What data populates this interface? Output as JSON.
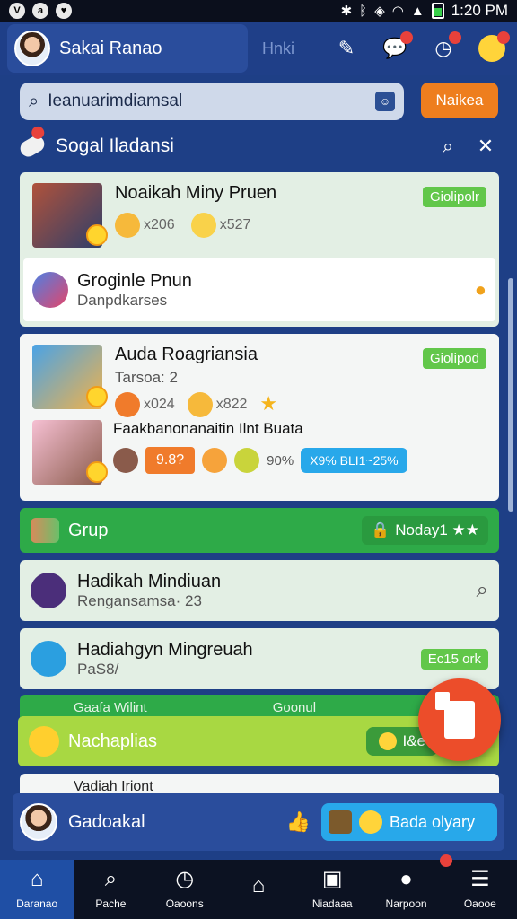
{
  "status_bar": {
    "time": "1:20 PM"
  },
  "app_bar": {
    "user_name": "Sakai Ranao",
    "hint": "Hnki"
  },
  "search": {
    "value": "Ieanuarimdiamsal",
    "button": "Naikea"
  },
  "section": {
    "title": "Sogal Iladansi"
  },
  "cards": [
    {
      "title": "Noaikah Miny Pruen",
      "tag": "Giolipolr",
      "stat1": "x206",
      "stat2": "x527",
      "sub_title": "Groginle Pnun",
      "sub_caption": "Danpdkarses"
    },
    {
      "title": "Auda Roagriansia",
      "caption": "Tarsoa: 2",
      "tag": "Giolipod",
      "stat1": "x024",
      "stat2": "x822",
      "row2_title": "Faakbanonanaitin Ilnt Buata",
      "chip_value": "9.8?",
      "percent": "90%",
      "blue_chip": "X9% BLI1~25%"
    }
  ],
  "grup_bar": {
    "title": "Grup",
    "right": "Noday1 ★★"
  },
  "list": [
    {
      "title": "Hadikah Mindiuan",
      "sub": "Rengansamsa· 23"
    },
    {
      "title": "Hadiahgyn Mingreuah",
      "sub": "PaS8/",
      "tag": "Ec15 ork"
    }
  ],
  "partial": {
    "left": "Gaafa  Wilint",
    "right": "Goonul"
  },
  "lime_bar": {
    "title": "Nachaplias",
    "right": "I&e"
  },
  "peek": {
    "text": "Vadiah Iriont"
  },
  "footer": {
    "name": "Gadoakal",
    "cta": "Bada olyary"
  },
  "nav": [
    {
      "label": "Daranao",
      "icon": "home-icon"
    },
    {
      "label": "Pache",
      "icon": "search-icon"
    },
    {
      "label": "Oaoons",
      "icon": "timer-icon"
    },
    {
      "label": "",
      "icon": "house-icon"
    },
    {
      "label": "Niadaaa",
      "icon": "bag-icon"
    },
    {
      "label": "Narpoon",
      "icon": "chat-icon"
    },
    {
      "label": "Oaooe",
      "icon": "menu-icon"
    }
  ]
}
